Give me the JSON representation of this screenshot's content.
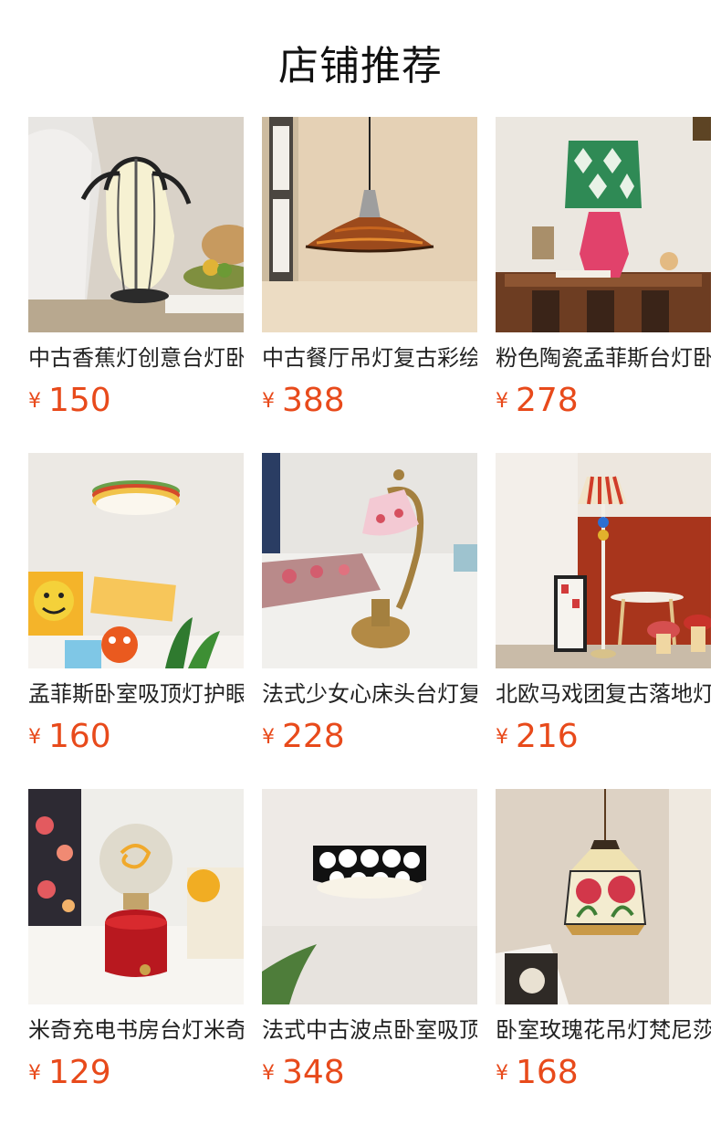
{
  "page": {
    "title": "店铺推荐"
  },
  "products": [
    {
      "name": "中古香蕉灯创意台灯卧室床头灯",
      "currency": "¥",
      "price": "150",
      "image": "banana-table-lamp-photo"
    },
    {
      "name": "中古餐厅吊灯复古彩绘玻璃吊灯",
      "currency": "¥",
      "price": "388",
      "image": "pendant-lamp-photo"
    },
    {
      "name": "粉色陶瓷孟菲斯台灯卧室床头灯",
      "currency": "¥",
      "price": "278",
      "image": "pink-ceramic-table-lamp-photo"
    },
    {
      "name": "孟菲斯卧室吸顶灯护眼灯",
      "currency": "¥",
      "price": "160",
      "image": "memphis-ceiling-lamp-photo"
    },
    {
      "name": "法式少女心床头台灯复古",
      "currency": "¥",
      "price": "228",
      "image": "french-desk-lamp-photo"
    },
    {
      "name": "北欧马戏团复古落地灯",
      "currency": "¥",
      "price": "216",
      "image": "circus-floor-lamp-photo"
    },
    {
      "name": "米奇充电书房台灯米奇灯泡",
      "currency": "¥",
      "price": "129",
      "image": "bulb-desk-lamp-photo"
    },
    {
      "name": "法式中古波点卧室吸顶灯",
      "currency": "¥",
      "price": "348",
      "image": "polka-dot-ceiling-lamp-photo"
    },
    {
      "name": "卧室玫瑰花吊灯梵尼莎",
      "currency": "¥",
      "price": "168",
      "image": "rose-stained-glass-pendant-photo"
    }
  ],
  "colors": {
    "price": "#e84a1b",
    "title": "#111111",
    "text": "#222222"
  }
}
